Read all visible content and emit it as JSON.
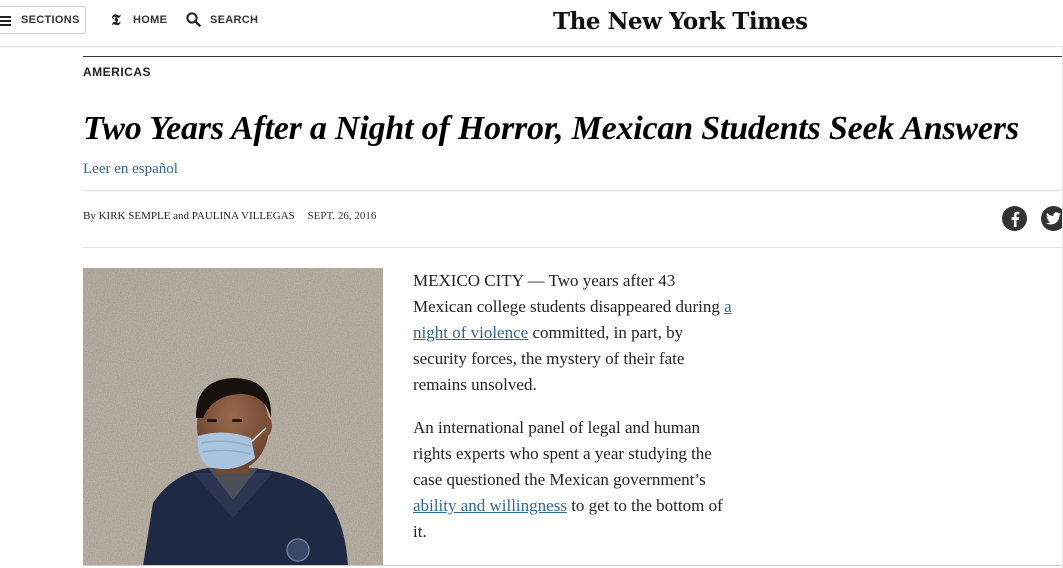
{
  "nav": {
    "sections_label": "SECTIONS",
    "home_label": "HOME",
    "search_label": "SEARCH",
    "logo_text": "The New York Times"
  },
  "article": {
    "kicker": "AMERICAS",
    "headline": "Two Years After a Night of Horror, Mexican Students Seek Answers",
    "translation_link": "Leer en español",
    "byline_prefix": "By",
    "author_1": "KIRK SEMPLE",
    "byline_and": "and",
    "author_2": "PAULINA VILLEGAS",
    "date": "SEPT. 26, 2016"
  },
  "share": {
    "facebook_icon": "facebook-icon",
    "twitter_icon": "twitter-icon"
  },
  "story": {
    "p1_before": "MEXICO CITY — Two years after 43 Mexican college students disappeared during ",
    "p1_link": "a night of violence",
    "p1_after": " committed, in part, by security forces, the mystery of their fate remains unsolved.",
    "p2_before": "An international panel of legal and human rights experts who spent a year studying the case questioned the Mexican government’s ",
    "p2_link": "ability and willingness",
    "p2_after": " to get to the bottom of it."
  },
  "colors": {
    "link": "#326891",
    "text": "#222222",
    "share_bg": "#333333"
  }
}
